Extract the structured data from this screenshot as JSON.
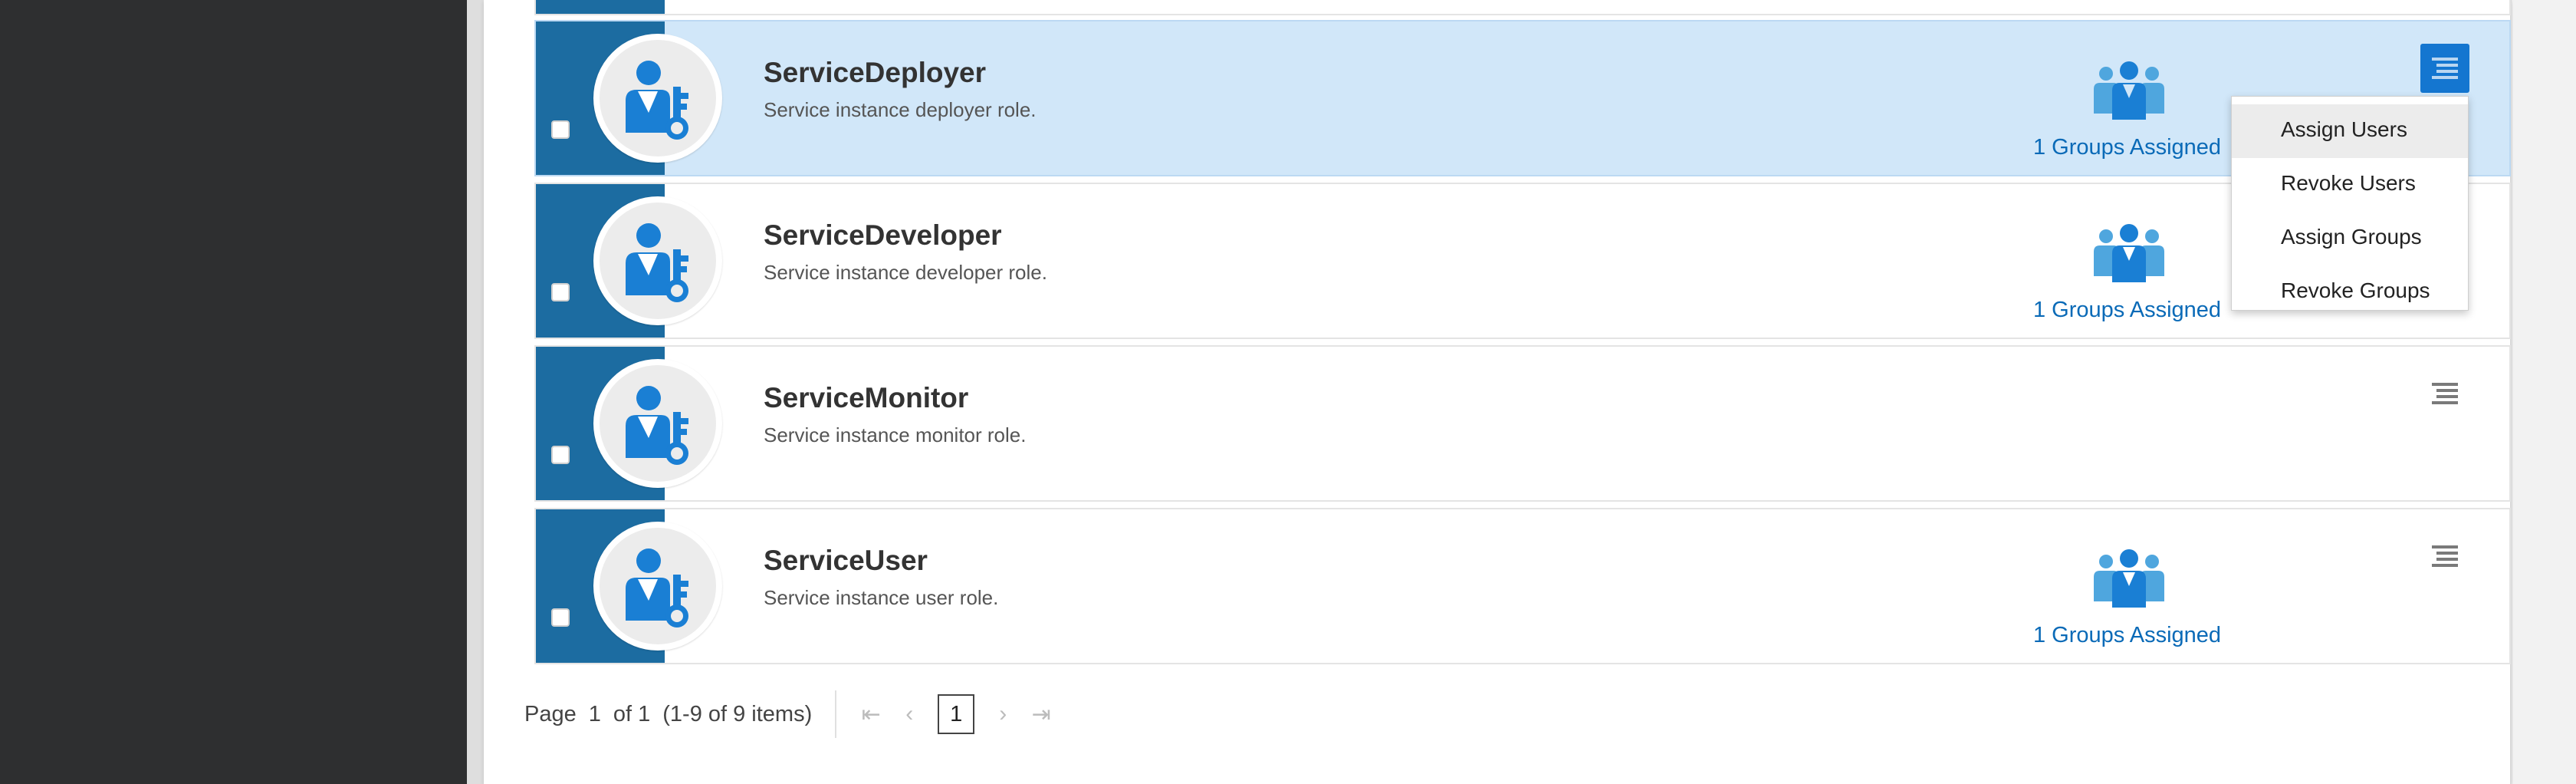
{
  "roles": [
    {
      "name": "ServiceDeployer",
      "description": "Service instance deployer role.",
      "groups": "1 Groups Assigned"
    },
    {
      "name": "ServiceDeveloper",
      "description": "Service instance developer role.",
      "groups": "1 Groups Assigned"
    },
    {
      "name": "ServiceMonitor",
      "description": "Service instance monitor role.",
      "groups": ""
    },
    {
      "name": "ServiceUser",
      "description": "Service instance user role.",
      "groups": "1 Groups Assigned"
    }
  ],
  "menu": {
    "items": [
      "Assign Users",
      "Revoke Users",
      "Assign Groups",
      "Revoke Groups"
    ]
  },
  "pager": {
    "page_label": "Page",
    "page_num": "1",
    "of_label": "of 1",
    "items_label": "(1-9 of 9 items)",
    "current": "1",
    "first": "⇤",
    "prev": "‹",
    "next": "›",
    "last": "⇥"
  },
  "colors": {
    "tile": "#1c6ca1",
    "selected_row": "#d1e7f9",
    "link": "#0a6ab7",
    "icon_blue": "#1a7fd4"
  }
}
